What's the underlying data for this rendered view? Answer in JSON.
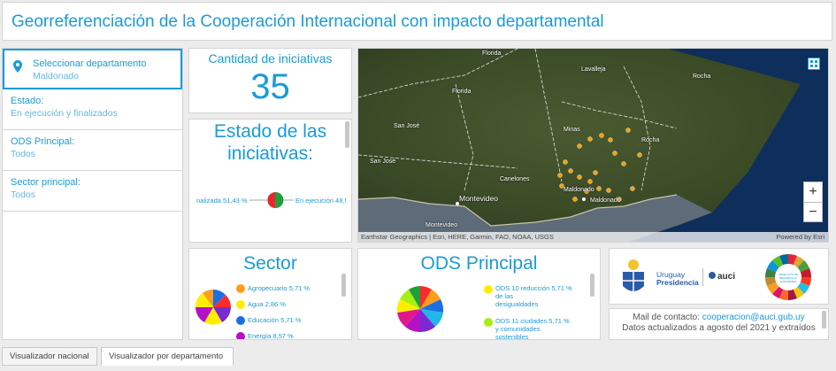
{
  "header": {
    "title": "Georreferenciación de la Cooperación Internacional con impacto departamental"
  },
  "sidebar": {
    "items": [
      {
        "label": "Seleccionar departamento",
        "value": "Maldonado"
      },
      {
        "label": "Estado:",
        "value": "En ejecución y finalizados"
      },
      {
        "label": "ODS Principal:",
        "value": "Todos"
      },
      {
        "label": "Sector principal:",
        "value": "Todos"
      }
    ]
  },
  "count": {
    "label": "Cantidad de iniciativas",
    "value": "35"
  },
  "estado": {
    "title_1": "Estado de las",
    "title_2": "iniciativas:",
    "left_label": "nalizada 51,43 %",
    "right_label": "En ejecución 48,!"
  },
  "map": {
    "attribution": "Earthstar Geographics | Esri, HERE, Garmin, FAO, NOAA, USGS",
    "powered": "Powered by Esri",
    "zoom_in": "+",
    "zoom_out": "−",
    "labels": {
      "florida_top": "Florida",
      "lavalleja": "Lavalleja",
      "rocha_top": "Rocha",
      "florida": "Florida",
      "san_jose_1": "San José",
      "minas": "Minas",
      "rocha": "Rocha",
      "san_jose_2": "San José",
      "canelones": "Canelones",
      "maldonado_1": "Maldonado",
      "montevideo_1": "Montevideo",
      "maldonado_2": "Maldonado",
      "montevideo_2": "Montevideo"
    }
  },
  "sector": {
    "title": "Sector",
    "legend": [
      {
        "label": "Agropecuario  5,71 %",
        "color": "#ff9d1c"
      },
      {
        "label": "Agua  2,86 %",
        "color": "#ffee00"
      },
      {
        "label": "Educación  5,71 %",
        "color": "#1b6fe0"
      },
      {
        "label": "Energía  8,57 %",
        "color": "#b410c4"
      }
    ]
  },
  "ods": {
    "title": "ODS Principal",
    "legend": [
      {
        "line1": "ODS 10 reducción  5,71 %",
        "line2": "de las",
        "line3": "desigualdades",
        "color": "#ffee00"
      },
      {
        "line1": "ODS 11 ciudades  5,71 %",
        "line2": "y comunidades",
        "line3": "sostenibles",
        "color": "#a6ef13"
      }
    ]
  },
  "logos": {
    "uruguay": "Uruguay",
    "presidencia": "Presidencia",
    "auci": "auci",
    "ods_text": "OBJETIVOS DE DESARROLLO SOSTENIBLE"
  },
  "contact": {
    "mail_label": "Mail de contacto:",
    "mail": "cooperacion@auci.gub.uy",
    "line2": "Datos actualizados a agosto del 2021 y extraídos"
  },
  "tabs": [
    {
      "label": "Visualizador nacional"
    },
    {
      "label": "Visualizador por departamento"
    }
  ]
}
